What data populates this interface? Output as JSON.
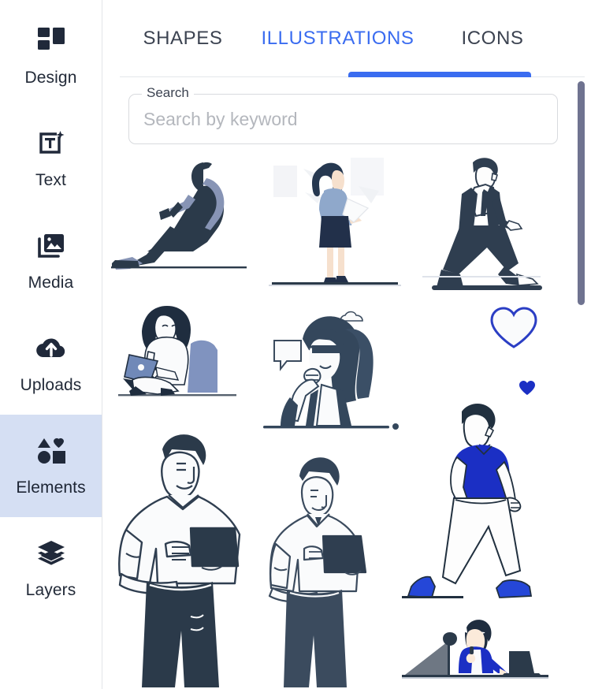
{
  "sidebar": {
    "items": [
      {
        "id": "design",
        "label": "Design",
        "icon": "grid-squares-icon",
        "active": false
      },
      {
        "id": "text",
        "label": "Text",
        "icon": "text-box-plus-icon",
        "active": false
      },
      {
        "id": "media",
        "label": "Media",
        "icon": "image-stack-icon",
        "active": false
      },
      {
        "id": "uploads",
        "label": "Uploads",
        "icon": "cloud-upload-icon",
        "active": false
      },
      {
        "id": "elements",
        "label": "Elements",
        "icon": "shapes-icon",
        "active": true
      },
      {
        "id": "layers",
        "label": "Layers",
        "icon": "layers-stack-icon",
        "active": false
      }
    ],
    "active_highlight_color": "#d5dff3"
  },
  "tabs": {
    "items": [
      {
        "id": "shapes",
        "label": "SHAPES",
        "active": false
      },
      {
        "id": "illustrations",
        "label": "ILLUSTRATIONS",
        "active": true
      },
      {
        "id": "icons",
        "label": "ICONS",
        "active": false
      }
    ],
    "active_color": "#3a6cf0",
    "inactive_color": "#3c4351"
  },
  "search": {
    "label": "Search",
    "value": "",
    "placeholder": "Search by keyword"
  },
  "results": {
    "items": [
      {
        "id": "seated-man-phone",
        "name": "seated man with phone silhouette"
      },
      {
        "id": "standing-businesswoman",
        "name": "standing businesswoman with device"
      },
      {
        "id": "walking-man-suit",
        "name": "walking man in dark suit"
      },
      {
        "id": "woman-laptop-cushion",
        "name": "woman sitting cross-legged with laptop"
      },
      {
        "id": "woman-sunglasses-thinking",
        "name": "woman with sunglasses thinking"
      },
      {
        "id": "heart-outline",
        "name": "heart outline"
      },
      {
        "id": "heart-filled",
        "name": "filled heart"
      },
      {
        "id": "man-holding-tablet",
        "name": "man in white shirt holding tablet"
      },
      {
        "id": "man-tablet-looking-up",
        "name": "man with tablet looking up"
      },
      {
        "id": "walking-man-blue-shirt",
        "name": "walking man in blue t-shirt"
      },
      {
        "id": "woman-presenting-desk",
        "name": "woman presenting at desk with microphone and laptop"
      }
    ]
  },
  "palette": {
    "navy": "#2f3e50",
    "dark_navy": "#2b3a4a",
    "slate_blue": "#8794b5",
    "accent_blue": "#3a6cf0",
    "royal_blue": "#1b2fc4",
    "skin": "#f6e0cd",
    "offwhite": "#fafbfc"
  },
  "scrollbar": {
    "thumb_color": "#6f7390",
    "position": "top"
  }
}
